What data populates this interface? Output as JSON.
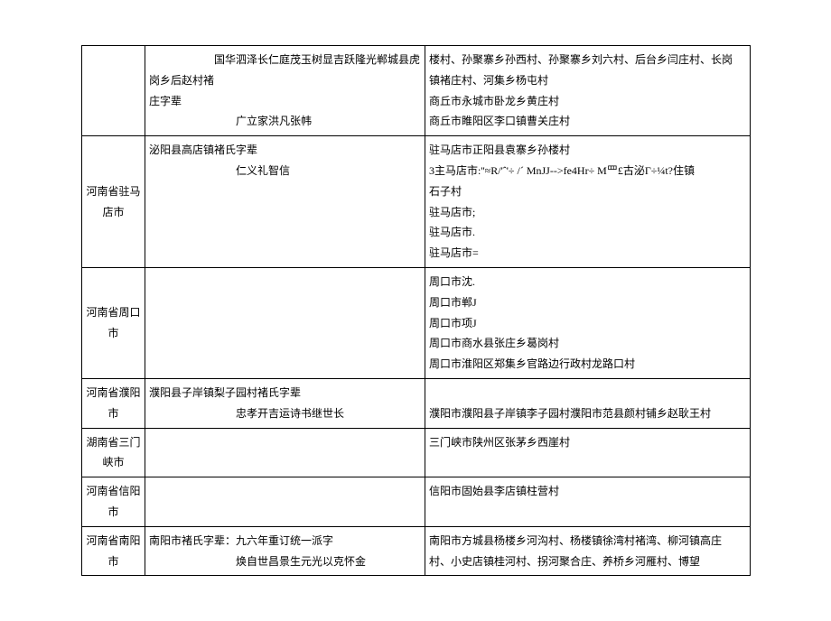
{
  "rows": [
    {
      "region": "",
      "b_lines": [
        {
          "cls": "indent-1",
          "text": "国华泗泽长仁庭茂玉树显吉跃隆光郸城县虎岗乡后赵村褚"
        },
        {
          "cls": "",
          "text": "庄字辈"
        },
        {
          "cls": "indent-2",
          "text": "广立家洪凡张帏"
        }
      ],
      "c_lines": [
        {
          "text": "楼村、孙聚寨乡孙西村、孙聚寨乡刘六村、后台乡闫庄村、长岗"
        },
        {
          "text": "镇褚庄村、河集乡杨屯村"
        },
        {
          "text": "商丘市永城市卧龙乡黄庄村"
        },
        {
          "text": "商丘市睢阳区李口镇曹关庄村"
        }
      ]
    },
    {
      "region": "河南省驻马店市",
      "b_lines": [
        {
          "cls": "",
          "text": "泌阳县高店镇褚氏字辈"
        },
        {
          "cls": "indent-2",
          "text": "仁义礼智信"
        }
      ],
      "c_lines": [
        {
          "text": "驻马店市正阳县袁寨乡孙楼村"
        },
        {
          "text": "3主马店市:''≈R/'ˆ'÷ /ˊ MnJJ-->fe4Hr÷     M罒£古泌Γ÷¼t?住镇"
        },
        {
          "text": "石子村"
        },
        {
          "text": "驻马店市;"
        },
        {
          "text": "驻马店市."
        },
        {
          "text": "驻马店市="
        }
      ]
    },
    {
      "region": "河南省周口市",
      "b_lines": [],
      "c_lines": [
        {
          "text": "周口市沈."
        },
        {
          "text": "周口市郸J"
        },
        {
          "text": "周口市项J"
        },
        {
          "text": "周口市商水县张庄乡葛岗村"
        },
        {
          "text": "周口市淮阳区郑集乡官路边行政村龙路口村"
        }
      ]
    },
    {
      "region": "河南省濮阳市",
      "b_lines": [
        {
          "cls": "",
          "text": "濮阳县子岸镇梨子园村褚氏字辈"
        },
        {
          "cls": "indent-2",
          "text": "忠孝开吉运诗书继世长"
        }
      ],
      "c_lines": [
        {
          "text": ""
        },
        {
          "text": "濮阳市濮阳县子岸镇李子园村濮阳市范县颜村铺乡赵耿王村"
        }
      ]
    },
    {
      "region": "湖南省三门峡市",
      "b_lines": [],
      "c_lines": [
        {
          "text": "三门峡市陕州区张茅乡西崖村"
        }
      ]
    },
    {
      "region": "河南省信阳市",
      "b_lines": [],
      "c_lines": [
        {
          "text": "信阳市固始县李店镇柱营村"
        }
      ]
    },
    {
      "region": "河南省南阳市",
      "b_lines": [
        {
          "cls": "",
          "text": "南阳市褚氏字辈：九六年重订统一派字"
        },
        {
          "cls": "indent-2",
          "text": "焕自世昌景生元光以克怀金"
        }
      ],
      "c_lines": [
        {
          "text": "南阳市方城县杨楼乡河沟村、杨楼镇徐湾村褚湾、柳河镇高庄"
        },
        {
          "text": "村、小史店镇桂河村、拐河聚合庄、养桥乡河雁村、博望"
        }
      ]
    }
  ]
}
